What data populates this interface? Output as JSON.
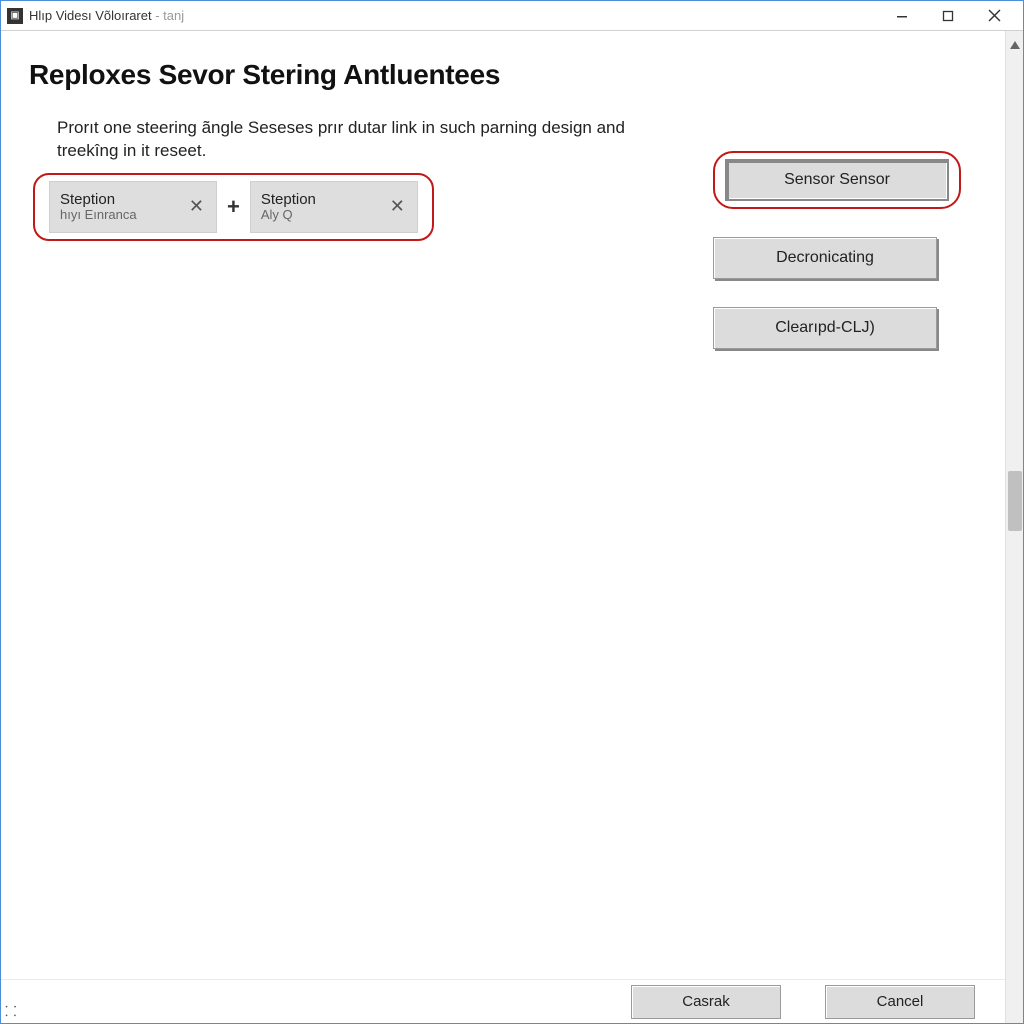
{
  "titlebar": {
    "icon_glyph": "▣",
    "title_main": "Hlıp Videsı Võloıraret",
    "title_muted": " - tanj"
  },
  "heading": "Reploxes Sevor Stering Antluentees",
  "description": "Prorıt one steering ãngle Seseses prır dutar link in such parning design and treekîng in it reseet.",
  "chips": [
    {
      "label": "Steption",
      "sub": "hıyı Eınranca"
    },
    {
      "label": "Steption",
      "sub": "Aly Q"
    }
  ],
  "plus_glyph": "+",
  "close_glyph": "✕",
  "buttons": {
    "sensor": "Sensor Sensor",
    "decron": "Decronicating",
    "clear": "Clearıpd-CLJ)"
  },
  "footer": {
    "casrak": "Casrak",
    "cancel": "Cancel"
  },
  "corner_glyph": "⸬"
}
